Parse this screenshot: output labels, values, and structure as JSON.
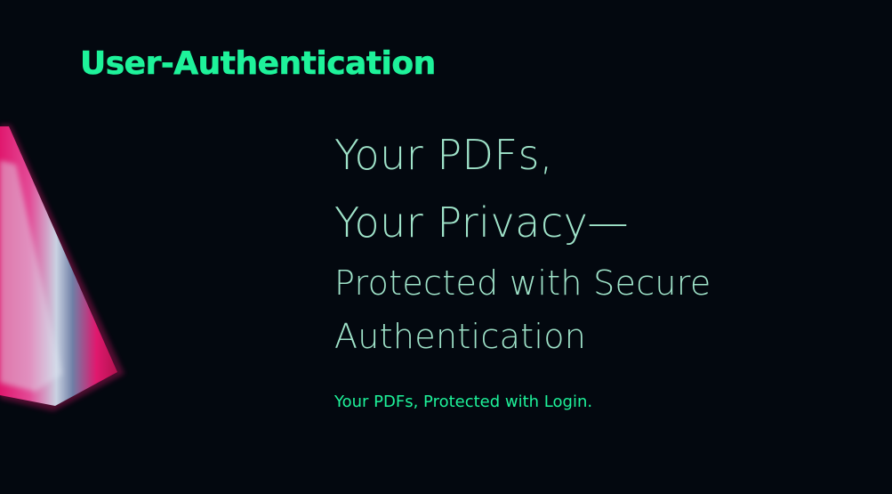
{
  "colors": {
    "background": "#03080f",
    "brand": "#1ef29a",
    "hero_text": "#9fe3c9",
    "accent_pink": "#e0186e",
    "accent_silver": "#c9d2e2"
  },
  "header": {
    "brand_title": "User-Authentication"
  },
  "hero": {
    "line1": "Your PDFs,",
    "line2": "Your Privacy—",
    "line3": "Protected with Secure",
    "line4": "Authentication"
  },
  "tagline": "Your PDFs, Protected with Login.",
  "decoration": {
    "icon": "abstract-cone-graphic"
  }
}
